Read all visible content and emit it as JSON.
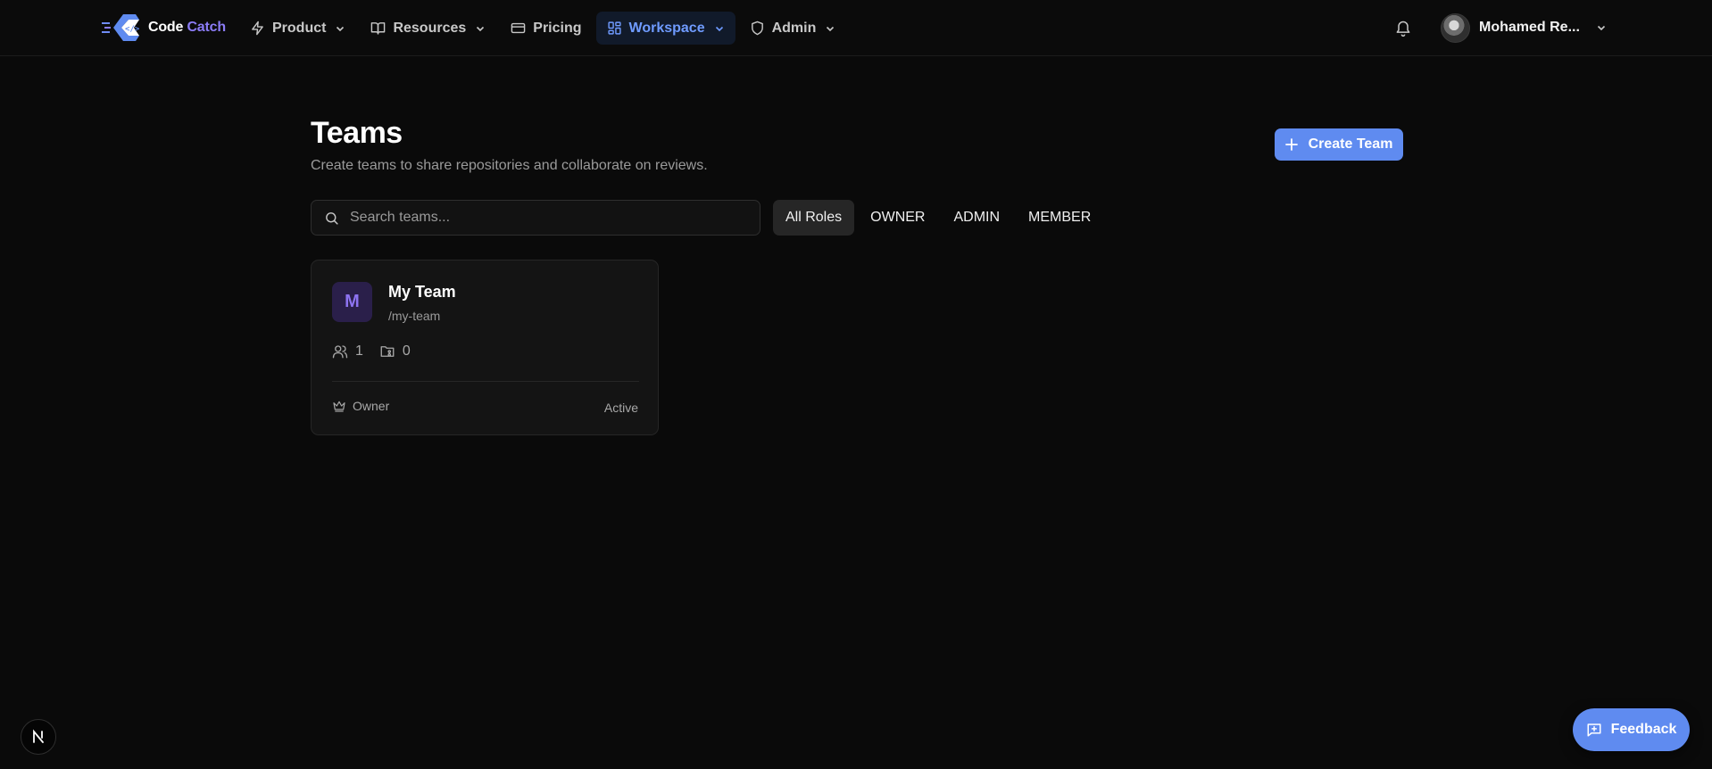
{
  "brand": {
    "name_part1": "Code",
    "name_part2": "Catch",
    "logo_icon": "code-catch-logo-icon"
  },
  "nav": {
    "items": [
      {
        "label": "Product",
        "icon": "zap-icon",
        "dropdown": true
      },
      {
        "label": "Resources",
        "icon": "book-open-icon",
        "dropdown": true
      },
      {
        "label": "Pricing",
        "icon": "credit-card-icon",
        "dropdown": false
      },
      {
        "label": "Workspace",
        "icon": "layout-grid-icon",
        "dropdown": true,
        "active": true
      },
      {
        "label": "Admin",
        "icon": "shield-icon",
        "dropdown": true
      }
    ],
    "notifications_icon": "bell-icon",
    "user": {
      "name": "Mohamed Re..."
    }
  },
  "page": {
    "title": "Teams",
    "subtitle": "Create teams to share repositories and collaborate on reviews.",
    "create_button_label": "Create Team"
  },
  "filters": {
    "search_placeholder": "Search teams...",
    "search_value": "",
    "roles": [
      {
        "label": "All Roles",
        "active": true
      },
      {
        "label": "OWNER",
        "active": false
      },
      {
        "label": "ADMIN",
        "active": false
      },
      {
        "label": "MEMBER",
        "active": false
      }
    ]
  },
  "teams": [
    {
      "initial": "M",
      "name": "My Team",
      "slug": "/my-team",
      "members": "1",
      "repositories": "0",
      "role": "Owner",
      "status": "Active"
    }
  ],
  "floating": {
    "next_badge_letter": "N",
    "feedback_label": "Feedback"
  },
  "colors": {
    "background": "#0a0a0a",
    "accent": "#5f8bf0",
    "active_nav_text": "#6f9bff",
    "brand_accent": "#8b7cf6",
    "team_avatar_bg": "#2a1f4a"
  }
}
